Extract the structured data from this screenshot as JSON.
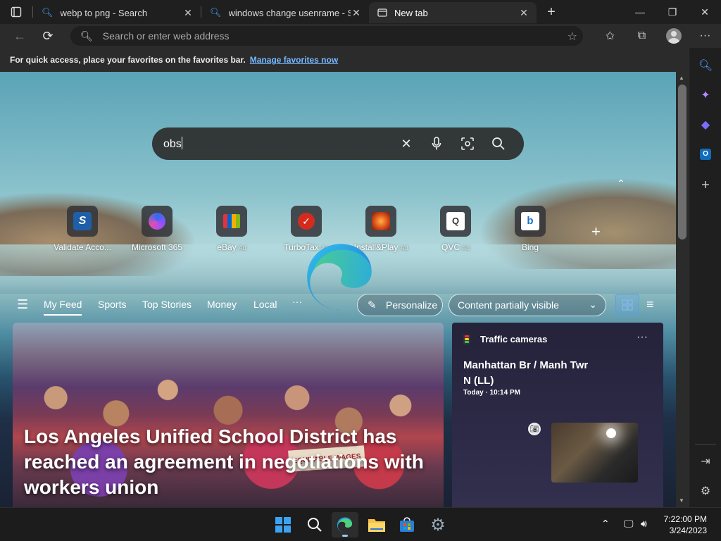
{
  "tabs": [
    {
      "title": "webp to png - Search",
      "icon": "search-icon"
    },
    {
      "title": "windows change usenrame - Sea",
      "icon": "search-icon"
    },
    {
      "title": "New tab",
      "icon": "newtab-icon",
      "active": true
    }
  ],
  "address_bar": {
    "placeholder": "Search or enter web address"
  },
  "favorites_bar": {
    "message": "For quick access, place your favorites on the favorites bar.",
    "link": "Manage favorites now"
  },
  "search": {
    "query": "obs"
  },
  "quick_links": [
    {
      "label": "Validate Acco...",
      "ad": ""
    },
    {
      "label": "Microsoft 365",
      "ad": ""
    },
    {
      "label": "eBay",
      "ad": "Ad"
    },
    {
      "label": "TurboTax",
      "ad": "Ad"
    },
    {
      "label": "Install&Play",
      "ad": "Ad"
    },
    {
      "label": "QVC",
      "ad": "Ad"
    },
    {
      "label": "Bing",
      "ad": ""
    }
  ],
  "feed_nav": {
    "items": [
      "My Feed",
      "Sports",
      "Top Stories",
      "Money",
      "Local"
    ],
    "more": "···",
    "personalize": "Personalize",
    "content_visibility": "Content partially visible"
  },
  "hero": {
    "headline": "Los Angeles Unified School District has reached an agreement in negotiations with workers union",
    "sign_text": "EQUITABLE WAGES"
  },
  "traffic": {
    "title": "Traffic cameras",
    "more": "···",
    "location": "Manhattan Br / Manh Twr N (LL)",
    "time": "Today · 10:14 PM"
  },
  "taskbar": {
    "time": "7:22:00 PM",
    "date": "3/24/2023"
  },
  "colors": {
    "accent": "#76b8ff",
    "tab_bar": "#1f1f1f",
    "toolbar": "#2b2b2b"
  }
}
